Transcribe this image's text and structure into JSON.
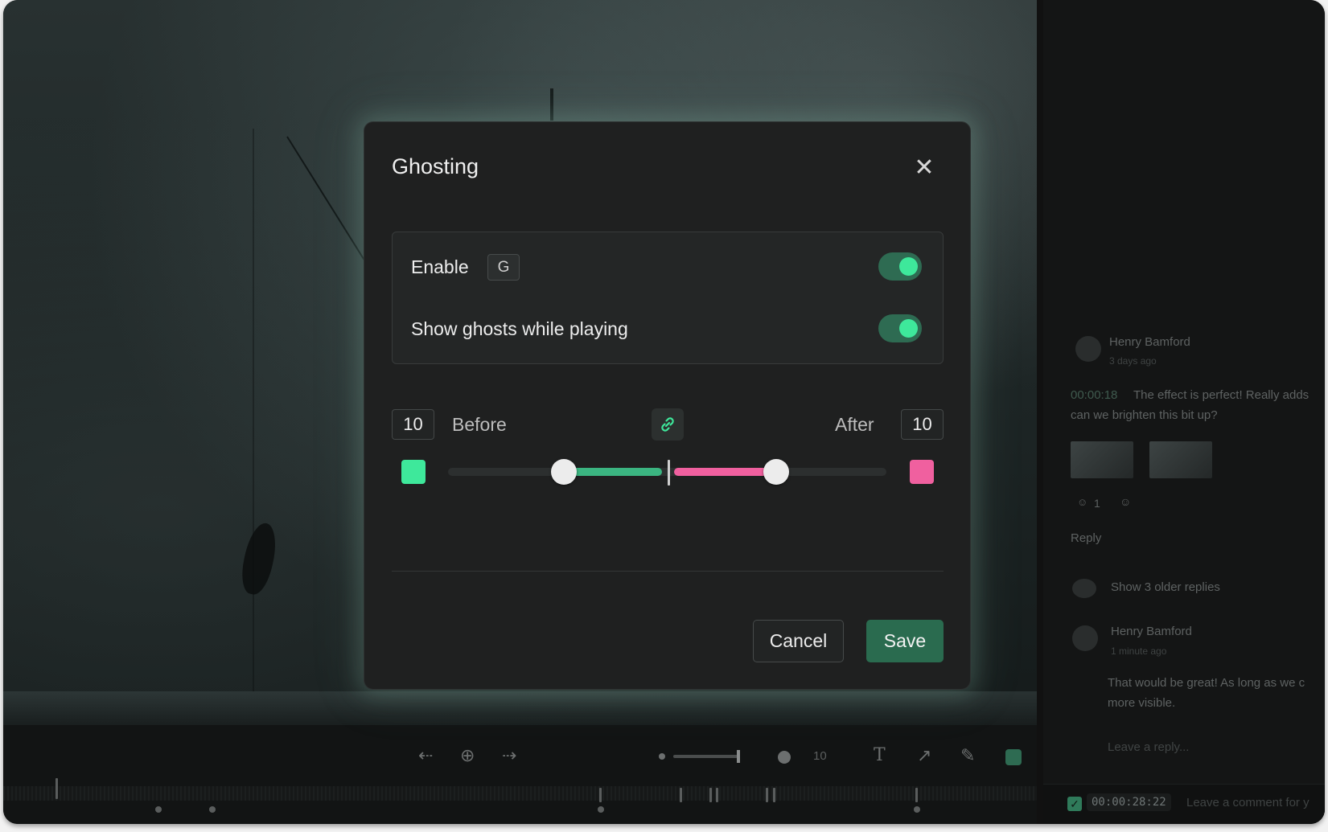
{
  "dialog": {
    "title": "Ghosting",
    "enable_label": "Enable",
    "enable_shortcut": "G",
    "enable_on": true,
    "show_ghosts_label": "Show ghosts while playing",
    "show_ghosts_on": true,
    "before_label": "Before",
    "before_value": "10",
    "after_label": "After",
    "after_value": "10",
    "before_color": "#3ee89b",
    "after_color": "#f0609f",
    "cancel_label": "Cancel",
    "save_label": "Save"
  },
  "toolbar": {
    "brush_size": "10"
  },
  "comments": {
    "thread": [
      {
        "author": "Henry Bamford",
        "time": "3 days ago",
        "timecode": "00:00:18",
        "text_line1": "The effect is perfect! Really adds",
        "text_line2": "can we brighten this bit up?",
        "reaction_count": "1",
        "reply_label": "Reply"
      }
    ],
    "older_replies": "Show 3 older replies",
    "reply": {
      "author": "Henry Bamford",
      "time": "1 minute ago",
      "text_line1": "That would be great! As long as we c",
      "text_line2": "more visible."
    },
    "leave_reply": "Leave a reply...",
    "footer_timecode": "00:00:28:22",
    "footer_placeholder": "Leave a comment for y"
  }
}
